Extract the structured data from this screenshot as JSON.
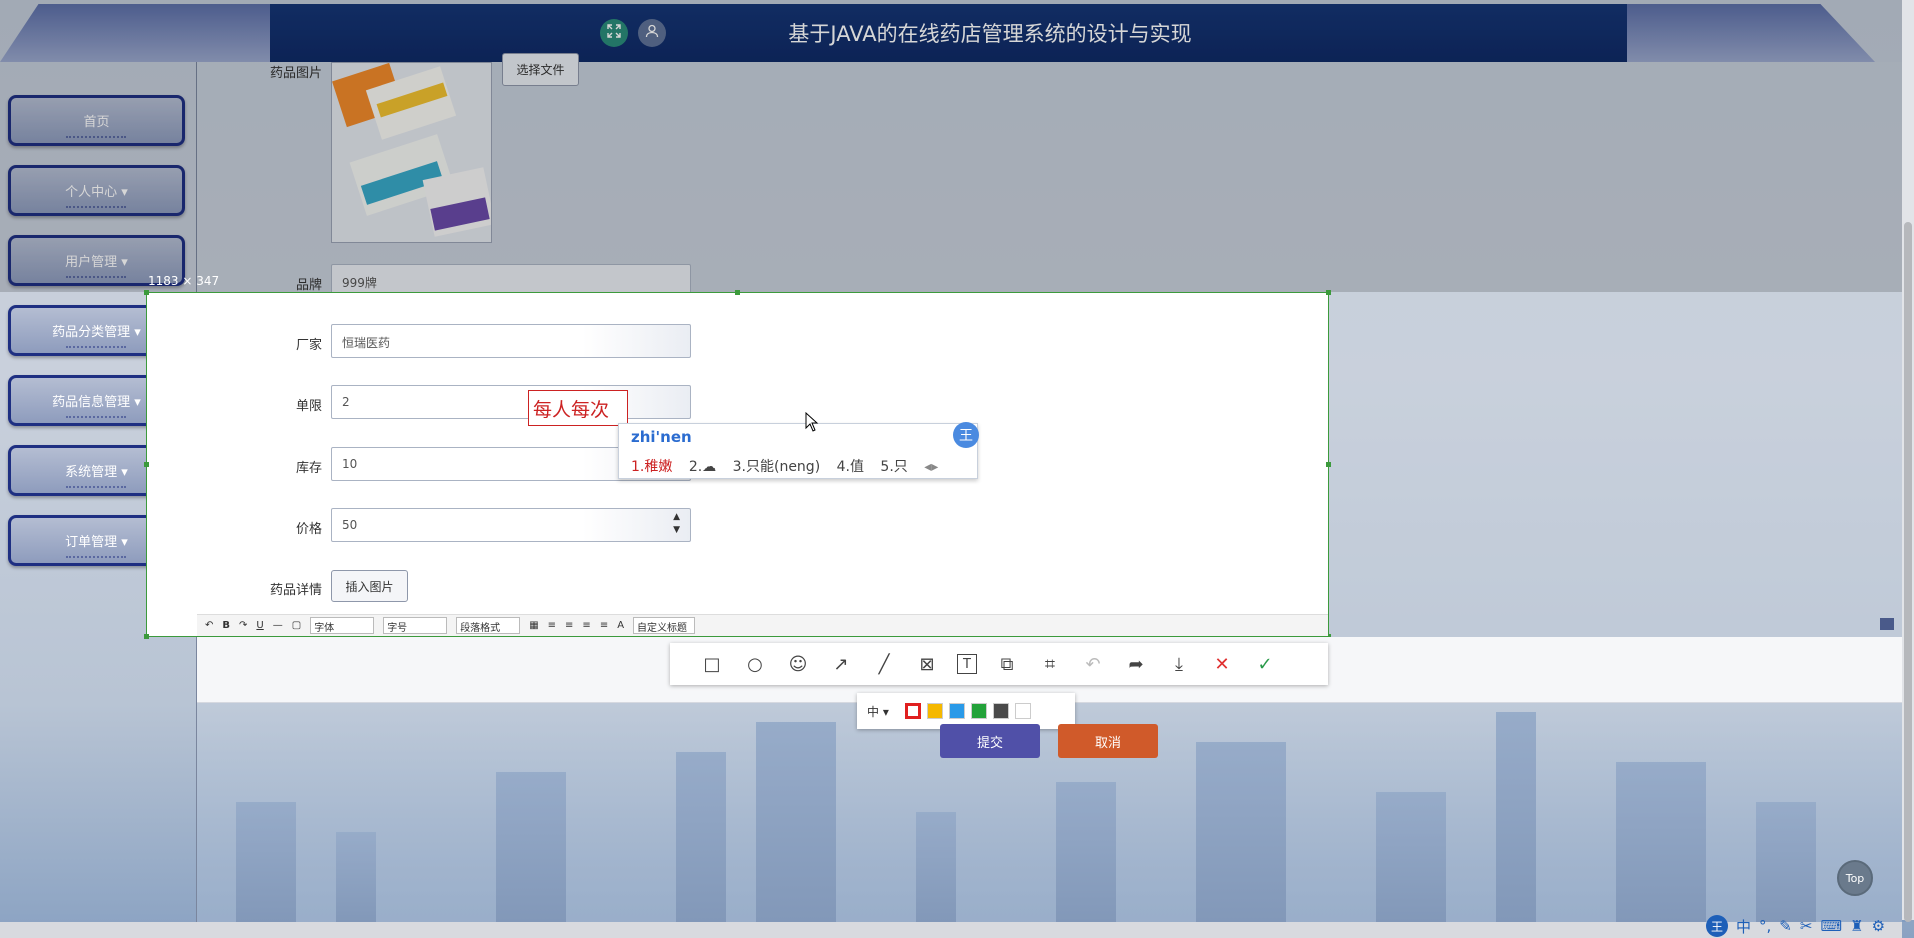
{
  "header": {
    "title": "基于JAVA的在线药店管理系统的设计与实现"
  },
  "sidebar": {
    "items": [
      {
        "label": "首页"
      },
      {
        "label": "个人中心 ▾"
      },
      {
        "label": "用户管理 ▾"
      },
      {
        "label": "药品分类管理 ▾"
      },
      {
        "label": "药品信息管理 ▾"
      },
      {
        "label": "系统管理 ▾"
      },
      {
        "label": "订单管理 ▾"
      }
    ]
  },
  "form": {
    "image_label": "药品图片",
    "choose_file": "选择文件",
    "brand_label": "品牌",
    "brand_value": "999牌",
    "maker_label": "厂家",
    "maker_value": "恒瑞医药",
    "limit_label": "单限",
    "limit_value": "2",
    "stock_label": "库存",
    "stock_value": "10",
    "price_label": "价格",
    "price_value": "50",
    "detail_label": "药品详情",
    "insert_image": "插入图片",
    "submit": "提交",
    "cancel": "取消"
  },
  "editor_toolbar": {
    "font": "字体",
    "size": "字号",
    "para": "段落格式",
    "custom": "自定义标题"
  },
  "snip": {
    "size_readout": "1183 × 347",
    "text_annotation": "每人每次",
    "font_size": "中 ▾",
    "colors": [
      "#e02020",
      "#f5b800",
      "#2a9ae8",
      "#23a23a",
      "#4a4a4a",
      "#ffffff"
    ]
  },
  "ime": {
    "pinyin": "zhi'nen",
    "candidates": [
      "1.稚嫩",
      "2.☁",
      "3.只能(neng)",
      "4.值",
      "5.只"
    ],
    "logo": "王"
  },
  "misc": {
    "top": "Top",
    "tray_ime": "王",
    "tray_lang": "中"
  }
}
